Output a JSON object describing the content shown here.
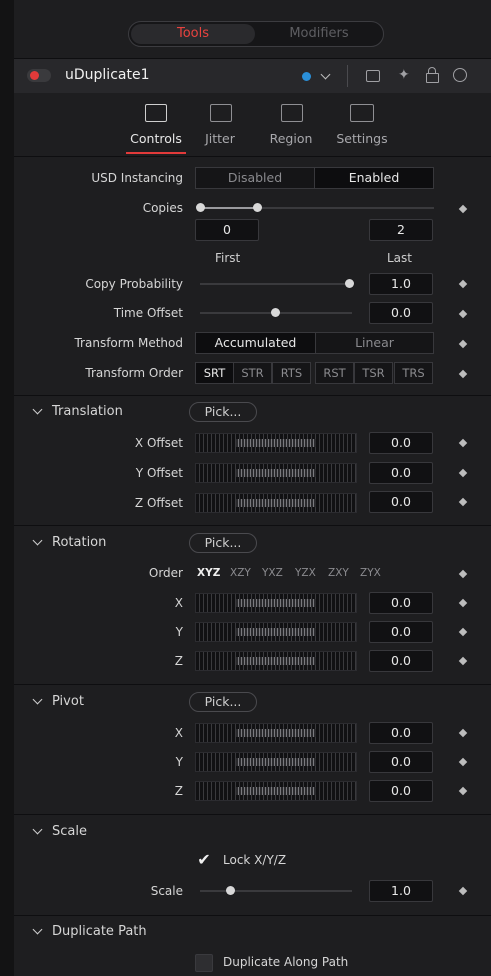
{
  "top_tabs": {
    "tools": "Tools",
    "modifiers": "Modifiers"
  },
  "node": {
    "name": "uDuplicate1"
  },
  "tabs": [
    {
      "label": "Controls"
    },
    {
      "label": "Jitter"
    },
    {
      "label": "Region"
    },
    {
      "label": "Settings"
    }
  ],
  "usd_instancing": {
    "label": "USD Instancing",
    "disabled": "Disabled",
    "enabled": "Enabled"
  },
  "copies": {
    "label": "Copies",
    "first_value": "0",
    "last_value": "2",
    "first_label": "First",
    "last_label": "Last"
  },
  "copy_probability": {
    "label": "Copy Probability",
    "value": "1.0"
  },
  "time_offset": {
    "label": "Time Offset",
    "value": "0.0"
  },
  "transform_method": {
    "label": "Transform Method",
    "accumulated": "Accumulated",
    "linear": "Linear"
  },
  "transform_order": {
    "label": "Transform Order",
    "options": [
      "SRT",
      "STR",
      "RTS",
      "RST",
      "TSR",
      "TRS"
    ]
  },
  "translation": {
    "title": "Translation",
    "pick": "Pick...",
    "x_label": "X Offset",
    "x_value": "0.0",
    "y_label": "Y Offset",
    "y_value": "0.0",
    "z_label": "Z Offset",
    "z_value": "0.0"
  },
  "rotation": {
    "title": "Rotation",
    "pick": "Pick...",
    "order_label": "Order",
    "orders": [
      "XYZ",
      "XZY",
      "YXZ",
      "YZX",
      "ZXY",
      "ZYX"
    ],
    "x_label": "X",
    "x_value": "0.0",
    "y_label": "Y",
    "y_value": "0.0",
    "z_label": "Z",
    "z_value": "0.0"
  },
  "pivot": {
    "title": "Pivot",
    "pick": "Pick...",
    "x_label": "X",
    "x_value": "0.0",
    "y_label": "Y",
    "y_value": "0.0",
    "z_label": "Z",
    "z_value": "0.0"
  },
  "scale": {
    "title": "Scale",
    "lock_label": "Lock X/Y/Z",
    "label": "Scale",
    "value": "1.0"
  },
  "duplicate_path": {
    "title": "Duplicate Path",
    "checkbox_label": "Duplicate Along Path"
  },
  "colors": {
    "accent_red": "#e23a3a",
    "node_dot_blue": "#2a8fd8",
    "background": "#1e1e20"
  }
}
